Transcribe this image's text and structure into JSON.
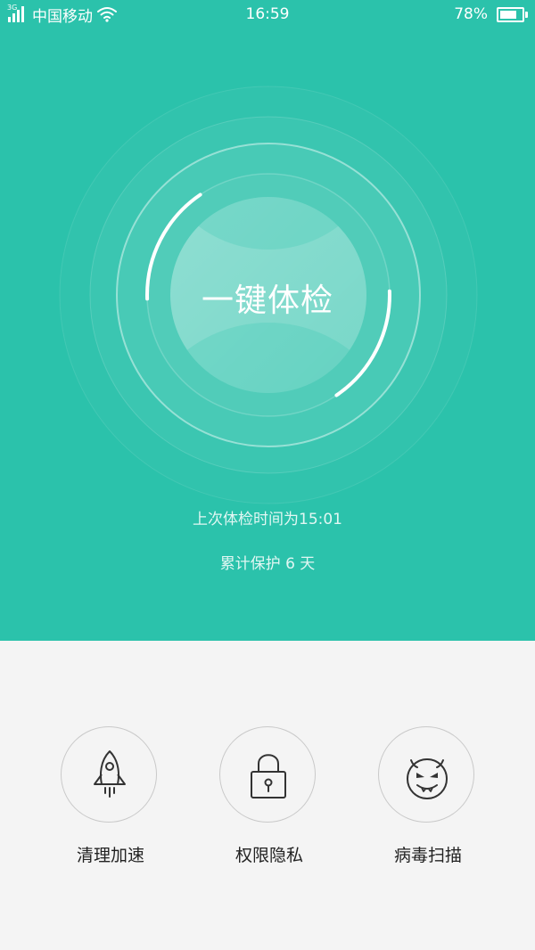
{
  "status_bar": {
    "network_type": "3G",
    "carrier": "中国移动",
    "time": "16:59",
    "battery_percent_text": "78%",
    "battery_level": 0.78
  },
  "main": {
    "check_button_label": "一键体检",
    "last_check_text": "上次体检时间为15:01",
    "protect_days_text": "累计保护 6 天",
    "progress_ring": 0.32
  },
  "tools": [
    {
      "label": "清理加速",
      "icon": "rocket-icon"
    },
    {
      "label": "权限隐私",
      "icon": "lock-icon"
    },
    {
      "label": "病毒扫描",
      "icon": "virus-face-icon"
    }
  ],
  "colors": {
    "primary": "#2bc2ab",
    "background": "#f4f4f4",
    "text_dark": "#222222",
    "icon_stroke": "#333333"
  }
}
